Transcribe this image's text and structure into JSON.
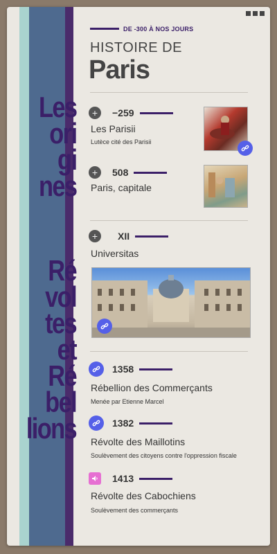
{
  "header": {
    "era": "DE -300 À  NOS JOURS",
    "pretitle": "HISTOIRE DE",
    "title": "Paris"
  },
  "side_labels": {
    "origins": [
      "Les",
      "ori",
      "gi",
      "nes"
    ],
    "revolts": [
      "Ré",
      "vol",
      "tes",
      "et",
      "Ré",
      "bel",
      "lions"
    ]
  },
  "timeline": [
    {
      "year": "−259",
      "title": "Les Parisii",
      "subtitle": "Lutèce cité des Parisii",
      "marker": "plus-icon"
    },
    {
      "year": "508",
      "title": "Paris, capitale",
      "subtitle": "",
      "marker": "plus-icon"
    },
    {
      "year": "XII",
      "title": "Universitas",
      "subtitle": "",
      "marker": "plus-icon"
    },
    {
      "year": "1358",
      "title": "Rébellion des Commerçants",
      "subtitle": "Menée par Etienne Marcel",
      "marker": "link-icon"
    },
    {
      "year": "1382",
      "title": "Révolte des Maillotins",
      "subtitle": "Soulèvement des citoyens contre l'oppression fiscale",
      "marker": "link-icon"
    },
    {
      "year": "1413",
      "title": "Révolte des Cabochiens",
      "subtitle": "Soulèvement des commerçants",
      "marker": "speaker-icon"
    }
  ],
  "colors": {
    "accent": "#3b1f68",
    "link": "#5560e8",
    "audio": "#e66fd2"
  }
}
